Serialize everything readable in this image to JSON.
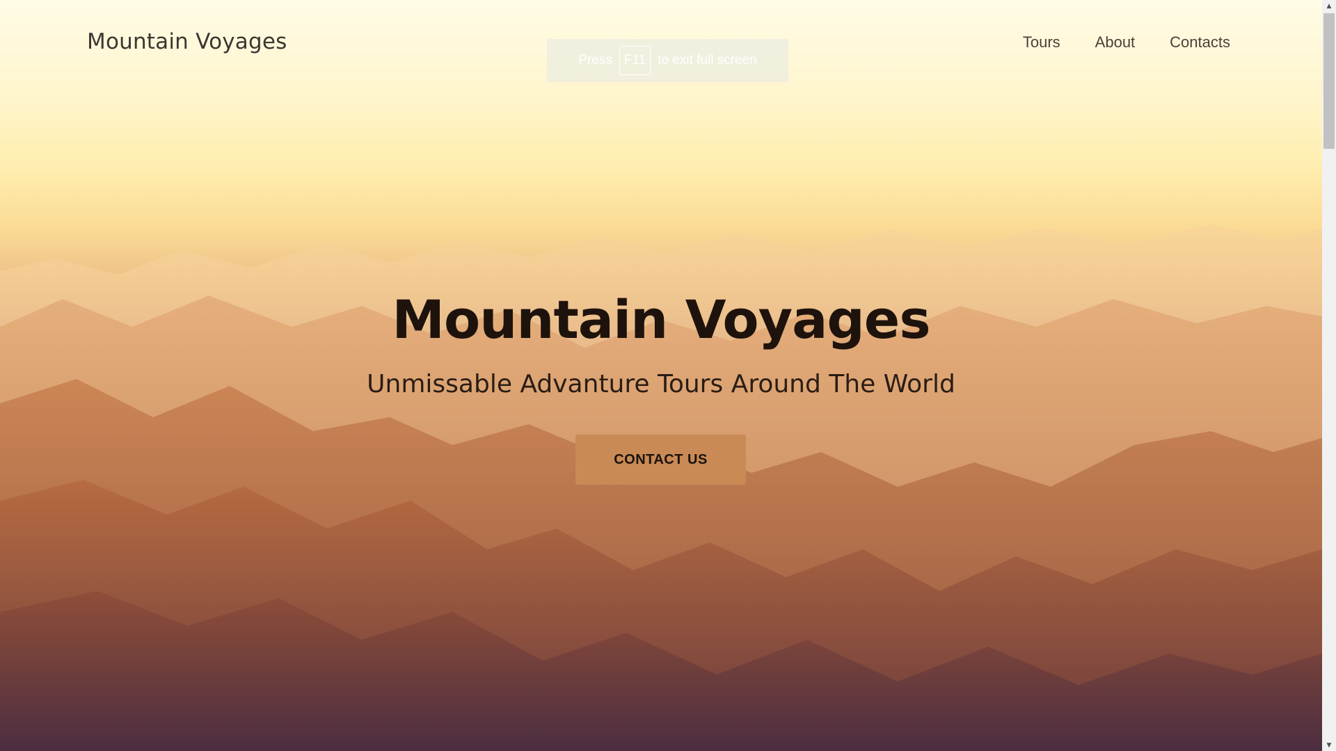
{
  "navbar": {
    "brand": "Mountain Voyages",
    "links": [
      {
        "label": "Tours"
      },
      {
        "label": "About"
      },
      {
        "label": "Contacts"
      }
    ]
  },
  "fullscreen_notice": {
    "before": "Press",
    "key": "F11",
    "after": "to exit full screen"
  },
  "hero": {
    "title": "Mountain Voyages",
    "subtitle": "Unmissable Advanture Tours Around The World",
    "cta_label": "CONTACT US"
  },
  "colors": {
    "sky_top": "#fffbe6",
    "haze": "#f0c58a",
    "mountain_low": "#4b2f42",
    "cta_background": "#c98a55",
    "title_text": "#1e130c"
  },
  "scrollbar": {
    "up_icon": "triangle-up",
    "down_icon": "triangle-down"
  }
}
